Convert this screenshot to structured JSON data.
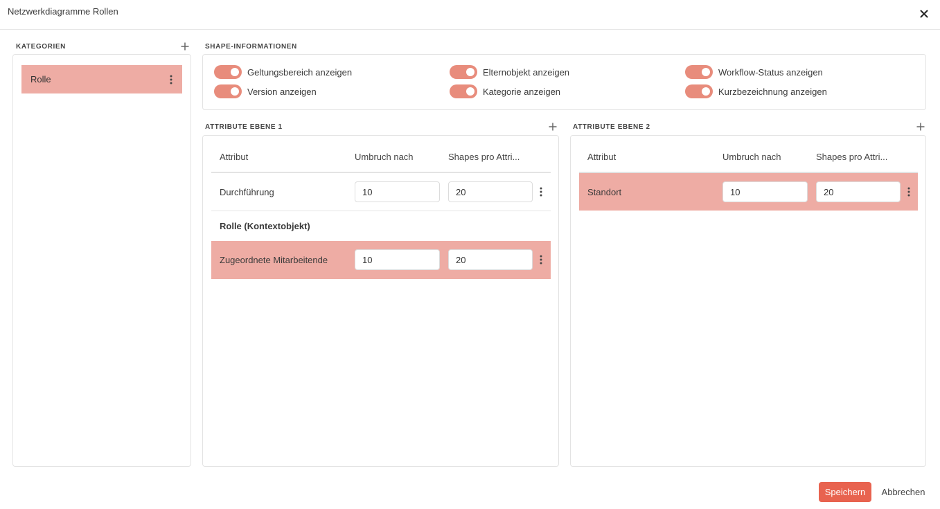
{
  "dialog": {
    "title": "Netzwerkdiagramme Rollen",
    "close_icon": "close-icon"
  },
  "colors": {
    "accent": "#e88c7c",
    "selected_row": "#eeaca4",
    "primary_button": "#e8634f"
  },
  "categories": {
    "label": "KATEGORIEN",
    "items": [
      {
        "label": "Rolle",
        "selected": true
      }
    ]
  },
  "shape_info": {
    "label": "SHAPE-INFORMATIONEN",
    "toggles": [
      {
        "label": "Geltungsbereich anzeigen",
        "on": true
      },
      {
        "label": "Elternobjekt anzeigen",
        "on": true
      },
      {
        "label": "Workflow-Status anzeigen",
        "on": true
      },
      {
        "label": "Version anzeigen",
        "on": true
      },
      {
        "label": "Kategorie anzeigen",
        "on": true
      },
      {
        "label": "Kurzbezeichnung anzeigen",
        "on": true
      }
    ]
  },
  "level1": {
    "label": "ATTRIBUTE EBENE 1",
    "columns": [
      "Attribut",
      "Umbruch nach",
      "Shapes pro Attri..."
    ],
    "rows": [
      {
        "label": "Durchführung",
        "wrap_after": "10",
        "shapes": "20",
        "selected": false
      },
      {
        "group_label": "Rolle (Kontextobjekt)"
      },
      {
        "label": "Zugeordnete Mitarbeitende",
        "wrap_after": "10",
        "shapes": "20",
        "selected": true
      }
    ]
  },
  "level2": {
    "label": "ATTRIBUTE EBENE 2",
    "columns": [
      "Attribut",
      "Umbruch nach",
      "Shapes pro Attri..."
    ],
    "rows": [
      {
        "label": "Standort",
        "wrap_after": "10",
        "shapes": "20",
        "selected": true
      }
    ]
  },
  "footer": {
    "save_label": "Speichern",
    "cancel_label": "Abbrechen"
  }
}
